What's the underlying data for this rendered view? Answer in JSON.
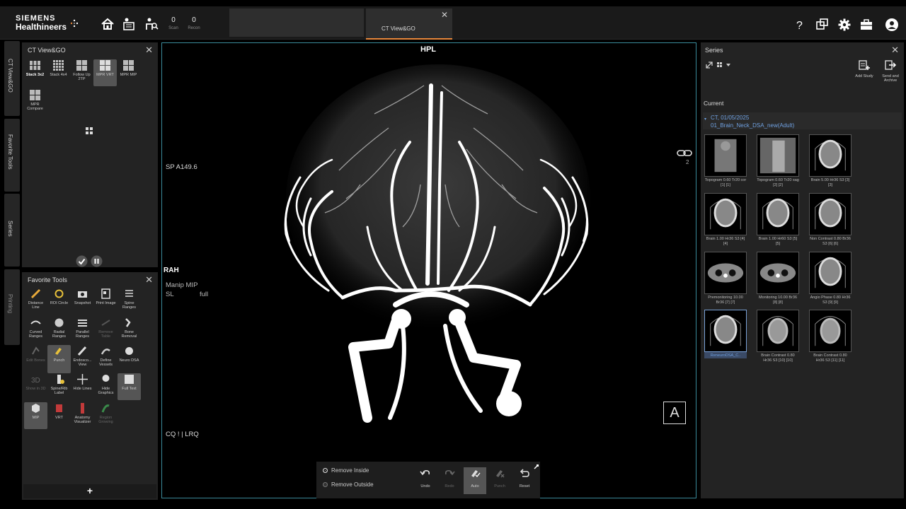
{
  "brand": {
    "line1": "SIEMENS",
    "line2": "Healthineers"
  },
  "counters": [
    {
      "value": "0",
      "label": "Scan"
    },
    {
      "value": "0",
      "label": "Recon"
    }
  ],
  "tabs": {
    "active_label": "CT View&GO"
  },
  "vertical_tabs": [
    "CT View&GO",
    "Favorite Tools",
    "Series",
    "Printing"
  ],
  "layouts_panel": {
    "title": "CT View&GO",
    "items": [
      "Stack 3x2",
      "Stack 4x4",
      "Follow Up 2TP",
      "MPR VRT",
      "MPR MIP",
      "MPR Compare"
    ]
  },
  "favorite_tools": {
    "title": "Favorite Tools",
    "items": [
      "Distance Line",
      "ROI Circle",
      "Snapshot",
      "Print Image",
      "Spine Ranges",
      "Curved Ranges",
      "Radial Ranges",
      "Parallel Ranges",
      "Remove Table",
      "Bone Removal",
      "Edit Bones",
      "Punch",
      "Endosco... View",
      "Define Vessels",
      "Neuro DSA",
      "Show in 3D",
      "Spine/Rib Label",
      "Hide Lines",
      "Hide Graphics",
      "Full Text",
      "MIP",
      "VRT",
      "Anatomy Visualizer",
      "Region Growing"
    ]
  },
  "viewer": {
    "top": "HPL",
    "left_mid": "SP A149.6",
    "orient": "RAH",
    "mode_line1": "Manip MIP",
    "mode_line2_a": "SL",
    "mode_line2_b": "full",
    "bottom_left": "CQ ! | LRQ",
    "link_count": "2",
    "corner_letter": "A"
  },
  "punch_toolbar": {
    "options": [
      "Remove Inside",
      "Remove Outside"
    ],
    "buttons": [
      "Undo",
      "Redo",
      "Auto",
      "Punch",
      "Reset"
    ]
  },
  "series": {
    "title": "Series",
    "add_study": "Add Study",
    "send_archive": "Send and Archive",
    "current_label": "Current",
    "study_line1": "CT, 01/05/2025",
    "study_line2": "01_Brain_Neck_DSA_new(Adult)",
    "thumbs": [
      "Topogram 0.60 Tr20 cor [1] [1]",
      "Topogram 0.60 Tr20 sag [2] [2]",
      "Brain 5.00 Hr36 S3 [3] [3]",
      "Brain 1.00 Hr36 S3 [4] [4]",
      "Brain 1.00 Hr60 S3 [5] [5]",
      "Non Contrast 0.80 Br36 S3 [6] [6]",
      "Premonitoring 10.00 Br36 [7] [7]",
      "Monitoring 10.00 Br36 [8] [8]",
      "Angio Phase 0.80 Hr36 S3 [9] [9]",
      "ReneuroDSA_C..",
      "Brain Contrast 0.80 Hr36 S3 [10] [10]",
      "Brain Contrast 0.80 Hr36 S3 [11] [11]"
    ]
  }
}
